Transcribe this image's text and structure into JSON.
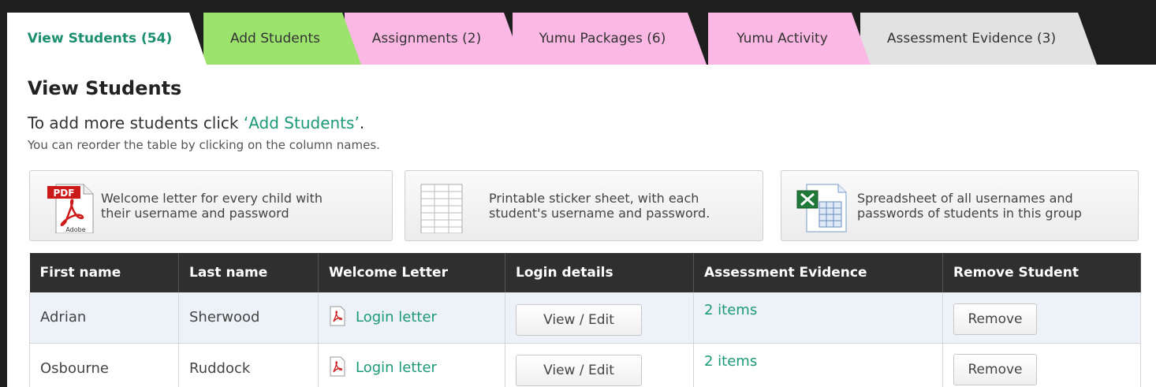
{
  "tabs": [
    {
      "label": "View Students (54)",
      "style": "active"
    },
    {
      "label": "Add Students",
      "style": "green"
    },
    {
      "label": "Assignments (2)",
      "style": "pink"
    },
    {
      "label": "Yumu Packages (6)",
      "style": "pink"
    },
    {
      "label": "Yumu Activity",
      "style": "pink"
    },
    {
      "label": "Assessment Evidence (3)",
      "style": "grey"
    }
  ],
  "page": {
    "title": "View Students",
    "intro_prefix": "To add more students click ",
    "intro_link": "‘Add Students’",
    "intro_suffix": ".",
    "hint": "You can reorder the table by clicking on the column names."
  },
  "downloads": [
    {
      "icon": "pdf-adobe-icon",
      "icon_label_top": "PDF",
      "icon_label_bottom": "Adobe",
      "line1": "Welcome letter for every child with",
      "line2": "their username and password"
    },
    {
      "icon": "sticker-sheet-icon",
      "line1": "Printable sticker sheet, with each",
      "line2": "student's username and password."
    },
    {
      "icon": "excel-spreadsheet-icon",
      "line1": "Spreadsheet of all usernames and",
      "line2": "passwords of students in this group"
    }
  ],
  "table": {
    "headers": [
      "First name",
      "Last name",
      "Welcome Letter",
      "Login details",
      "Assessment Evidence",
      "Remove Student"
    ],
    "rows": [
      {
        "first": "Adrian",
        "last": "Sherwood",
        "letter": "Login letter",
        "login_btn": "View / Edit",
        "evidence": "2 items",
        "remove_btn": "Remove"
      },
      {
        "first": "Osbourne",
        "last": "Ruddock",
        "letter": "Login letter",
        "login_btn": "View / Edit",
        "evidence": "2 items",
        "remove_btn": "Remove"
      }
    ]
  },
  "colors": {
    "accent": "#1c9a78",
    "tab_green": "#9be36d",
    "tab_pink": "#fcb8e4",
    "tab_grey": "#e2e2e2",
    "header_dark": "#2f2f2f"
  }
}
